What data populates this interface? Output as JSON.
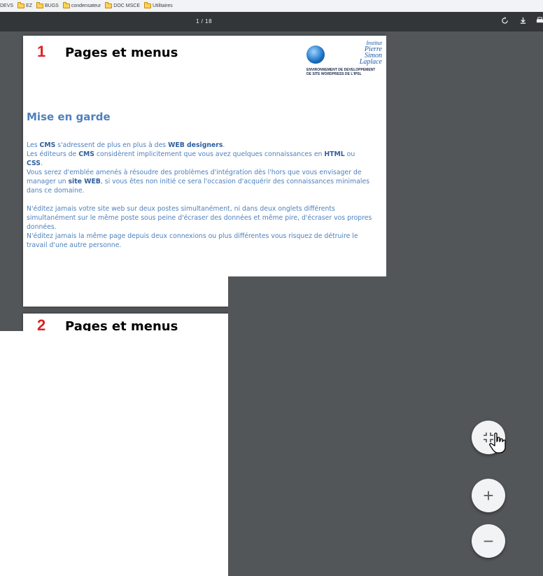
{
  "bookmarks_bar": {
    "items": [
      {
        "label": "DEVS"
      },
      {
        "label": "EZ"
      },
      {
        "label": "BUGS"
      },
      {
        "label": "condensateur"
      },
      {
        "label": "DOC MSCE"
      },
      {
        "label": "Utilitaires"
      }
    ]
  },
  "toolbar": {
    "page_indicator": "1 / 18",
    "icons": [
      "rotate-icon",
      "download-icon",
      "print-icon"
    ]
  },
  "page1": {
    "number": "1",
    "title": "Pages et menus",
    "logo": {
      "line1": "Institut",
      "line2": "Pierre",
      "line3": "Simon",
      "line4": "Laplace",
      "subtitle1": "ENVIRONNEMENT DE DEVELOPPEMENT",
      "subtitle2": "DE SITE WORDPRESS DE L'IPSL"
    },
    "section_title": "Mise en garde",
    "p1_a": "Les ",
    "p1_b": "CMS",
    "p1_c": " s'adressent de plus en plus à des ",
    "p1_d": "WEB designers",
    "p1_e": ".",
    "p2_a": "Les éditeurs de ",
    "p2_b": "CMS",
    "p2_c": " considèrent implicitement que vous avez quelques connaissances en ",
    "p2_d": "HTML",
    "p2_e": " ou ",
    "p2_f": "CSS",
    "p2_g": ".",
    "p3_a": "Vous serez d'emblée amenés à résoudre des problèmes d'intégration dès l'hors que vous envisager de manager un ",
    "p3_b": "site WEB",
    "p3_c": ", si vous êtes non initié ce sera l'occasion d'acquérir des connaissances minimales dans ce domaine.",
    "p4": "N'éditez jamais votre site web sur deux postes simultanément, ni dans deux onglets différents simultanément sur le même poste sous peine d'écraser des données et même pire, d'écraser vos propres données.",
    "p5": "N'éditez jamais la même page depuis deux connexions ou plus différentes vous risquez de détruire le travail d'une autre personne."
  },
  "page2": {
    "number": "2",
    "title": "Pages et menus"
  },
  "zoom_controls": {
    "fit_icon": "fit-to-page-icon",
    "plus": "+",
    "minus": "−"
  },
  "colors": {
    "toolbar_bg": "#323639",
    "viewer_bg": "#525659",
    "heading_blue": "#4f81bd",
    "slide_number_red": "#e02020"
  }
}
